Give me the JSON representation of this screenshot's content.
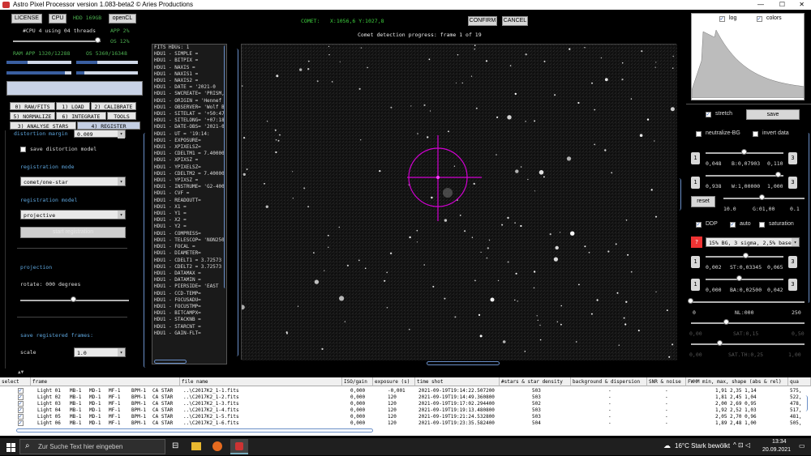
{
  "window": {
    "title": "Astro Pixel Processor version 1.083-beta2 © Aries Productions"
  },
  "top_buttons": {
    "license": "LICENSE",
    "cpu": "CPU",
    "hdd": "HDD 169GB",
    "opencl": "openCL"
  },
  "system": {
    "cpu_threads": "#CPU 4  using 04 threads",
    "app_pct": "APP 2%",
    "os_pct": "OS 12%",
    "ram_app": "RAM  APP 1320/12288",
    "ram_os": "OS 5360/16348",
    "cpu_usage_fraction": 0.85
  },
  "tabs": [
    {
      "label": "0) RAW/FITS"
    },
    {
      "label": "1) LOAD"
    },
    {
      "label": "2) CALIBRATE"
    },
    {
      "label": "5) NORMALIZE"
    },
    {
      "label": "6) INTEGRATE"
    },
    {
      "label": "TOOLS"
    },
    {
      "label": "3) ANALYSE STARS"
    },
    {
      "label": "4) REGISTER"
    }
  ],
  "register": {
    "distortion_margin_label": "distortion margin",
    "distortion_margin_value": "0.009",
    "save_distortion_model": "save distortion model",
    "registration_mode_label": "registration mode",
    "registration_mode_value": "comet/one-star",
    "registration_model_label": "registration model",
    "registration_model_value": "projective",
    "start_registration": "start registration",
    "projection_label": "projection",
    "rotate_label": "rotate:  000 degrees",
    "save_registered_frames": "save registered frames:",
    "scale_label": "scale",
    "scale_value": "1.0"
  },
  "comet_header": {
    "comet_label": "COMET:",
    "coords": "X:1056,6 Y:1027,8",
    "confirm": "CONFIRM",
    "cancel": "CANCEL",
    "progress_text": "Comet detection progress: frame 1 of 19"
  },
  "fits_header": {
    "title": "FITS HDUs: 1",
    "lines": [
      "HDU1 - SIMPLE  =",
      "HDU1 - BITPIX  =",
      "HDU1 - NAXIS   =",
      "HDU1 - NAXIS1  =",
      "HDU1 - NAXIS2  =",
      "HDU1 - DATE    = '2021-0",
      "HDU1 - SWCREATE= 'PRISM,",
      "HDU1 - ORIGIN  = 'Hennef",
      "HDU1 - OBSERVER= 'Wolf B",
      "HDU1 - SITELAT = '+50:47",
      "HDU1 - SITELONG= '+07:18",
      "HDU1 - DATE-OBS= '2021-0",
      "HDU1 - UT      = '19:14:",
      "HDU1 - EXPOSURE=",
      "HDU1 - XPIXELSZ=",
      "HDU1 - CDELTM1 = 7.40000",
      "HDU1 - XPIXSZ  =",
      "HDU1 - YPIXELSZ=",
      "HDU1 - CDELTM2 = 7.40000",
      "HDU1 - YPIXSZ  =",
      "HDU1 - INSTRUME= 'G2-400",
      "HDU1 - CVF     =",
      "HDU1 - READOUTT=",
      "HDU1 - X1      =",
      "HDU1 - Y1      =",
      "HDU1 - X2      =",
      "HDU1 - Y2      =",
      "HDU1 - COMPRESS=",
      "HDU1 - TELESCOP= 'NON250",
      "HDU1 - FOCAL   =",
      "HDU1 - DIAMETER=",
      "HDU1 - CDELT1  = 3.72573",
      "HDU1 - CDELT2  = 3.72573",
      "HDU1 - DATAMAX =",
      "HDU1 - DATAMIN =",
      "HDU1 - PIERSIDE= 'EAST",
      "HDU1 - CCD-TEMP=",
      "HDU1 - FOCUSADU=",
      "HDU1 - FOCUSTMP=",
      "HDU1 - BITCAMPX=",
      "HDU1 - STACKNB =",
      "HDU1 - STARCNT =",
      "HDU1 - GAIN-FLT="
    ]
  },
  "histogram": {
    "log": "log",
    "colors": "colors"
  },
  "stretch_panel": {
    "stretch": "stretch",
    "save": "save",
    "neutralize_bg": "neutralize-BG",
    "invert_data": "invert data",
    "row1": {
      "a": "0,048",
      "b": "B:0,07903",
      "c": "0,110"
    },
    "row2": {
      "a": "0,938",
      "b": "W:1,00000",
      "c": "1,000"
    },
    "reset": "reset",
    "row3": {
      "a": "10.0",
      "b": "G:01,00",
      "c": "0.1"
    },
    "ddp": "DDP",
    "auto": "auto",
    "saturation": "saturation",
    "preset": "15% BG, 3 sigma, 2,5% base",
    "row4": {
      "a": "0,002",
      "b": "ST:0,03345",
      "c": "0,065"
    },
    "row5": {
      "a": "0,000",
      "b": "BA:0,02500",
      "c": "0,042"
    },
    "row6": {
      "a": "0",
      "b": "NL:000",
      "c": "250"
    },
    "row7": {
      "a": "0,00",
      "b": "SAT:0,15",
      "c": "0,50"
    },
    "row8": {
      "a": "0,00",
      "b": "SAT.TH:0,25",
      "c": "1,00"
    },
    "num1": "1",
    "num3": "3"
  },
  "table": {
    "columns": [
      "select",
      "frame",
      "file name",
      "ISO/gain",
      "exposure (s)",
      "time shot",
      "#stars & star density",
      "background & dispersion",
      "SNR & noise",
      "FWHM min, max, shape (abs & rel)",
      "qua"
    ],
    "rows": [
      [
        "Light 01",
        "MB-1",
        "MD-1",
        "MF-1",
        "BPM-1",
        "CA STAR",
        "..\\C2017K2_1-1.fits",
        "0,000",
        "-0,001",
        "2021-09-19T19:14:22.507200",
        "503",
        "-",
        "-",
        "1,91 2,35 1,14",
        "575,"
      ],
      [
        "Light 02",
        "MB-1",
        "MD-1",
        "MF-1",
        "BPM-1",
        "CA STAR",
        "..\\C2017K2_1-2.fits",
        "0,000",
        "120",
        "2021-09-19T19:14:49.360800",
        "503",
        "-",
        "-",
        "1,81 2,45 1,04",
        "522,"
      ],
      [
        "Light 03",
        "MB-1",
        "MD-1",
        "MF-1",
        "BPM-1",
        "CA STAR",
        "..\\C2017K2_1-3.fits",
        "0,000",
        "120",
        "2021-09-19T19:17:02.294400",
        "502",
        "-",
        "-",
        "2,00 2,69 0,95",
        "478,"
      ],
      [
        "Light 04",
        "MB-1",
        "MD-1",
        "MF-1",
        "BPM-1",
        "CA STAR",
        "..\\C2017K2_1-4.fits",
        "0,000",
        "120",
        "2021-09-19T19:19:13.480800",
        "503",
        "-",
        "-",
        "1,92 2,52 1,03",
        "517,"
      ],
      [
        "Light 05",
        "MB-1",
        "MD-1",
        "MF-1",
        "BPM-1",
        "CA STAR",
        "..\\C2017K2_1-5.fits",
        "0,000",
        "120",
        "2021-09-19T19:21:24.532800",
        "503",
        "-",
        "-",
        "2,05 2,70 0,96",
        "481,"
      ],
      [
        "Light 06",
        "MB-1",
        "MD-1",
        "MF-1",
        "BPM-1",
        "CA STAR",
        "..\\C2017K2_1-6.fits",
        "0,000",
        "120",
        "2021-09-19T19:23:35.582400",
        "504",
        "-",
        "-",
        "1,89 2,48 1,00",
        "505,"
      ]
    ]
  },
  "taskbar": {
    "search_placeholder": "Zur Suche Text hier eingeben",
    "weather": "16°C  Stark bewölkt",
    "time": "13:34",
    "date": "20.09.2021"
  }
}
